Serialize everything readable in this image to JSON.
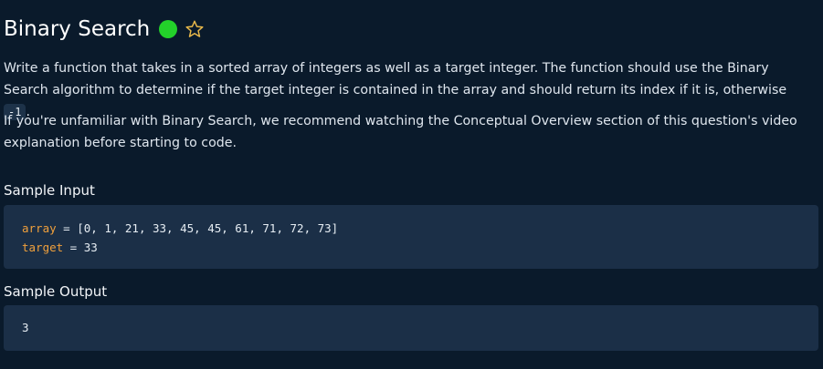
{
  "problem": {
    "title": "Binary Search",
    "difficulty_color": "#23d12a",
    "star_icon": "star-outline-icon",
    "paragraph1_before": "Write a function that takes in a sorted array of integers as well as a target integer. The function should use the Binary Search algorithm to determine if the target integer is contained in the array and should return its index if it is, otherwise ",
    "paragraph1_code": "-1",
    "paragraph1_after": ".",
    "paragraph2": "If you're unfamiliar with Binary Search, we recommend watching the Conceptual Overview section of this question's video explanation before starting to code."
  },
  "sample_input": {
    "heading": "Sample Input",
    "line1_var": "array",
    "line1_op": " = ",
    "line1_value": "[0, 1, 21, 33, 45, 45, 61, 71, 72, 73]",
    "line2_var": "target",
    "line2_op": " = ",
    "line2_value": "33"
  },
  "sample_output": {
    "heading": "Sample Output",
    "value": "3"
  },
  "colors": {
    "background": "#0a1a2b",
    "code_block": "#1b2f47",
    "variable": "#f0a03c",
    "star": "#e8b84a"
  }
}
